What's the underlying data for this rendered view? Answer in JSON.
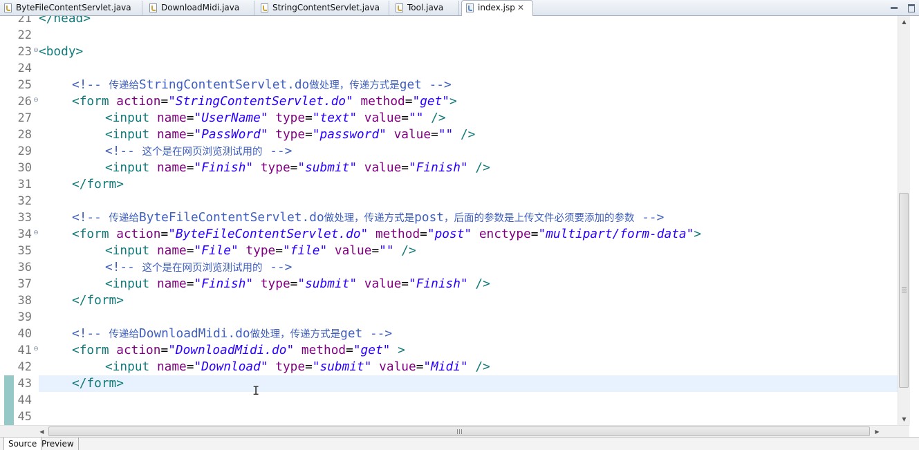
{
  "tabs": [
    {
      "label": "ByteFileContentServlet.java",
      "icon": "java-file-icon",
      "active": false
    },
    {
      "label": "DownloadMidi.java",
      "icon": "java-file-icon",
      "active": false
    },
    {
      "label": "StringContentServlet.java",
      "icon": "java-file-icon",
      "active": false
    },
    {
      "label": "Tool.java",
      "icon": "java-file-icon",
      "active": false
    },
    {
      "label": "index.jsp",
      "icon": "jsp-file-icon",
      "active": true,
      "close": "✕"
    }
  ],
  "editor": {
    "line_numbers": [
      "21",
      "22",
      "23",
      "24",
      "25",
      "26",
      "27",
      "28",
      "29",
      "30",
      "31",
      "32",
      "33",
      "34",
      "35",
      "36",
      "37",
      "38",
      "39",
      "40",
      "41",
      "42",
      "43",
      "44",
      "45"
    ],
    "fold_markers": {
      "23": "⊖",
      "26": "⊖",
      "34": "⊖",
      "41": "⊖"
    },
    "current_line": "43",
    "code": {
      "l21": "</head>",
      "l23_tag": "<body>",
      "l25_open": "<!-- ",
      "l25_cn1": "传递给",
      "l25_en": "StringContentServlet.do",
      "l25_cn2": "做处理，传递方式是",
      "l25_en2": "get -->",
      "l26_tag": "<form",
      "l26_a1": " action",
      "l26_v1": "\"StringContentServlet.do\"",
      "l26_a2": " method",
      "l26_v2": "\"get\"",
      "l26_end": ">",
      "l27_tag": "<input",
      "l27_a1": " name",
      "l27_v1": "\"UserName\"",
      "l27_a2": " type",
      "l27_v2": "\"text\"",
      "l27_a3": " value",
      "l27_v3": "\"\"",
      "l27_end": " />",
      "l28_tag": "<input",
      "l28_a1": " name",
      "l28_v1": "\"PassWord\"",
      "l28_a2": " type",
      "l28_v2": "\"password\"",
      "l28_a3": " value",
      "l28_v3": "\"\"",
      "l28_end": " />",
      "l29_open": "<!-- ",
      "l29_cn": "这个是在网页浏览测试用的",
      "l29_close": " -->",
      "l30_tag": "<input",
      "l30_a1": " name",
      "l30_v1": "\"Finish\"",
      "l30_a2": " type",
      "l30_v2": "\"submit\"",
      "l30_a3": " value",
      "l30_v3": "\"Finish\"",
      "l30_end": " />",
      "l31_tag": "</form>",
      "l33_open": "<!-- ",
      "l33_cn1": "传递给",
      "l33_en": "ByteFileContentServlet.do",
      "l33_cn2": "做处理，传递方式是",
      "l33_en2": "post",
      "l33_cn3": "，后面的参数是上传文件必须要添加的参数",
      "l33_close": " -->",
      "l34_tag": "<form",
      "l34_a1": " action",
      "l34_v1": "\"ByteFileContentServlet.do\"",
      "l34_a2": " method",
      "l34_v2": "\"post\"",
      "l34_a3": " enctype",
      "l34_v3": "\"multipart/form-data\"",
      "l34_end": ">",
      "l35_tag": "<input",
      "l35_a1": " name",
      "l35_v1": "\"File\"",
      "l35_a2": " type",
      "l35_v2": "\"file\"",
      "l35_a3": " value",
      "l35_v3": "\"\"",
      "l35_end": " />",
      "l36_open": "<!-- ",
      "l36_cn": "这个是在网页浏览测试用的",
      "l36_close": " -->",
      "l37_tag": "<input",
      "l37_a1": " name",
      "l37_v1": "\"Finish\"",
      "l37_a2": " type",
      "l37_v2": "\"submit\"",
      "l37_a3": " value",
      "l37_v3": "\"Finish\"",
      "l37_end": " />",
      "l38_tag": "</form>",
      "l40_open": "<!-- ",
      "l40_cn1": "传递给",
      "l40_en": "DownloadMidi.do",
      "l40_cn2": "做处理，传递方式是",
      "l40_en2": "get -->",
      "l41_tag": "<form",
      "l41_a1": " action",
      "l41_v1": "\"DownloadMidi.do\"",
      "l41_a2": " method",
      "l41_v2": "\"get\"",
      "l41_end": " >",
      "l42_tag": "<input",
      "l42_a1": " name",
      "l42_v1": "\"Download\"",
      "l42_a2": " type",
      "l42_v2": "\"submit\"",
      "l42_a3": " value",
      "l42_v3": "\"Midi\"",
      "l42_end": " />",
      "l43_tag": "</form>",
      "eq": "="
    }
  },
  "bottom_tabs": [
    {
      "label": "Source",
      "active": true
    },
    {
      "label": "Preview",
      "active": false
    }
  ],
  "icons": {
    "minimize": "minimize-icon",
    "maximize": "maximize-icon",
    "cursor": "I"
  },
  "colors": {
    "comment": "#3f5fbf",
    "tag": "#3f7f7f",
    "attribute_name": "#7f007f",
    "attribute_value": "#2a00ff",
    "current_line": "#e8f2fe"
  }
}
